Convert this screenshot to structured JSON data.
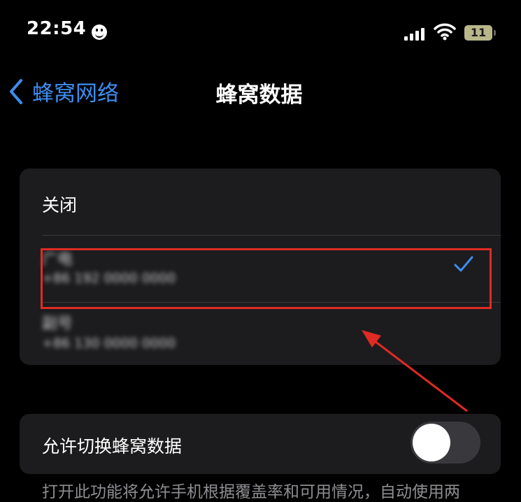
{
  "status_bar": {
    "time": "22:54",
    "battery": "11",
    "icons": [
      "face-icon",
      "signal-icon",
      "wifi-icon",
      "battery-icon"
    ]
  },
  "nav": {
    "back_label": "蜂窝网络",
    "title": "蜂窝数据"
  },
  "sim_options": {
    "off_label": "关闭",
    "sim1": {
      "name": "广电",
      "number": "+86 192 0000 0000",
      "selected": true
    },
    "sim2": {
      "name": "副号",
      "number": "+86 130 0000 0000",
      "selected": false
    }
  },
  "toggle": {
    "label": "允许切换蜂窝数据",
    "on": false
  },
  "footer_note": "打开此功能将允许手机根据覆盖率和可用情况，自动使用两",
  "colors": {
    "accent": "#3e8df0",
    "annotation": "#e02a24",
    "card": "#1c1c1e"
  }
}
